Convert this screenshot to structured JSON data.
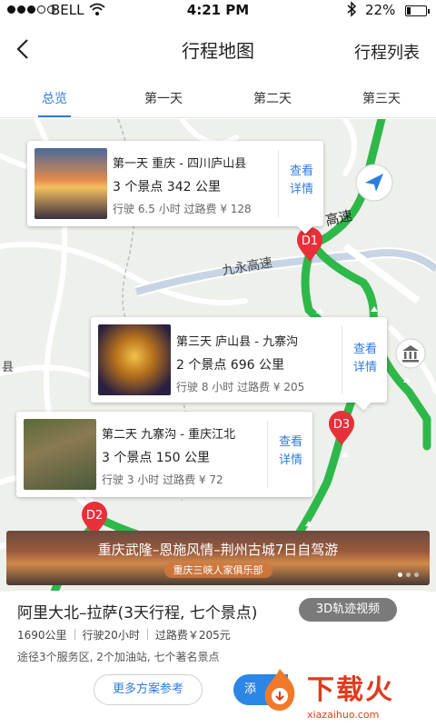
{
  "status_bar": {
    "carrier": "BELL",
    "time": "4:21 PM",
    "battery": "22%"
  },
  "nav": {
    "title": "行程地图",
    "right_action": "行程列表"
  },
  "tabs": [
    {
      "label": "总览",
      "active": true
    },
    {
      "label": "第一天",
      "active": false
    },
    {
      "label": "第二天",
      "active": false
    },
    {
      "label": "第三天",
      "active": false
    }
  ],
  "map": {
    "road_labels": [
      "九永高速",
      "高速"
    ],
    "place_labels": [
      "县"
    ],
    "pins": [
      "D1",
      "D2",
      "D3"
    ],
    "cards": [
      {
        "title": "第一天 重庆 - 四川庐山县",
        "summary": "3 个景点  342 公里",
        "detail": "行驶 6.5 小时  过路费 ¥ 128",
        "more": "查看\n详情"
      },
      {
        "title": "第三天 庐山县 - 九寨沟",
        "summary": "2 个景点  696 公里",
        "detail": "行驶 8 小时  过路费 ¥ 205",
        "more": "查看\n详情"
      },
      {
        "title": "第二天 九寨沟 - 重庆江北",
        "summary": "3 个景点  150 公里",
        "detail": "行驶 3 小时  过路费 ¥ 72",
        "more": "查看\n详情"
      }
    ]
  },
  "banner": {
    "title": "重庆武隆–恩施风情–荆州古城7日自驾游",
    "subtitle": "重庆三峡人家俱乐部"
  },
  "route": {
    "title": "阿里大北–拉萨(3天行程, 七个景点)",
    "video_button": "3D轨迹视频",
    "distance": "1690公里",
    "drive_time": "行驶20小时",
    "toll": "过路费￥205元",
    "via": "途径3个服务区, 2个加油站, 七个著名景点",
    "more_plans": "更多方案参考",
    "add_button": "添"
  },
  "watermark": {
    "name": "下载火",
    "url": "xiazaihuo.com"
  },
  "colors": {
    "accent": "#2c7ce0",
    "route": "#2eb84a",
    "pin": "#e8303a",
    "watermark": "#e03a1c"
  },
  "icons": [
    "back-chevron-icon",
    "wifi-icon",
    "bluetooth-icon",
    "battery-icon",
    "navigation-arrow-icon",
    "landmark-icon",
    "pin-icon"
  ]
}
